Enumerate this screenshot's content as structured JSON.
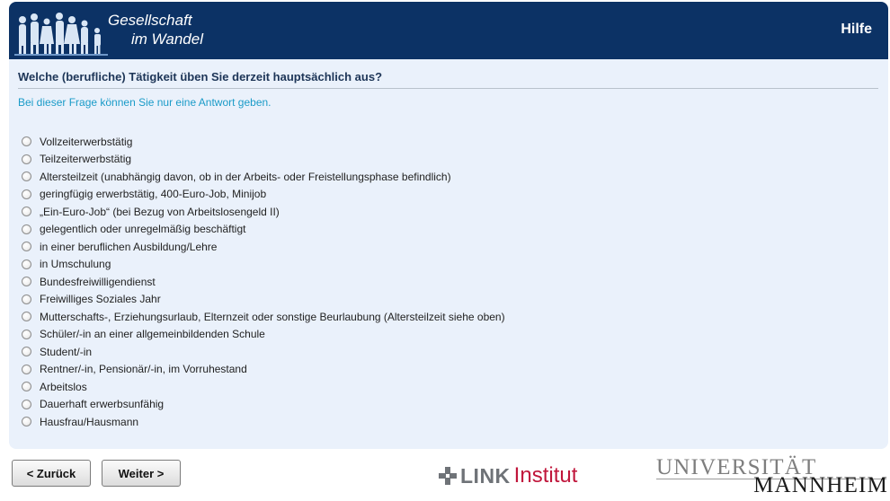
{
  "header": {
    "logo_line1": "Gesellschaft",
    "logo_line2": "im Wandel",
    "help_label": "Hilfe"
  },
  "question": {
    "title": "Welche (berufliche) Tätigkeit üben Sie derzeit hauptsächlich aus?",
    "hint": "Bei dieser Frage können Sie nur eine Antwort geben.",
    "options": [
      "Vollzeiterwerbstätig",
      "Teilzeiterwerbstätig",
      "Altersteilzeit (unabhängig davon, ob in der Arbeits- oder Freistellungsphase befindlich)",
      "geringfügig erwerbstätig, 400-Euro-Job, Minijob",
      "„Ein-Euro-Job“ (bei Bezug von Arbeitslosengeld II)",
      "gelegentlich oder unregelmäßig beschäftigt",
      "in einer beruflichen Ausbildung/Lehre",
      "in Umschulung",
      "Bundesfreiwilligendienst",
      "Freiwilliges Soziales Jahr",
      "Mutterschafts-, Erziehungsurlaub, Elternzeit oder sonstige Beurlaubung (Altersteilzeit siehe oben)",
      "Schüler/-in an einer allgemeinbildenden Schule",
      "Student/-in",
      "Rentner/-in, Pensionär/-in, im Vorruhestand",
      "Arbeitslos",
      "Dauerhaft erwerbsunfähig",
      "Hausfrau/Hausmann"
    ]
  },
  "nav": {
    "back_label": "< Zurück",
    "next_label": "Weiter >"
  },
  "footer": {
    "link_word": "LINK",
    "link_institut": "Institut",
    "uni_line1": "UNIVERSITÄT",
    "uni_line2": "MANNHEIM"
  },
  "colors": {
    "header_bg": "#0c3265",
    "panel_bg": "#eaf1fb",
    "hint_text": "#1a9bc8",
    "link_red": "#c0163b"
  }
}
